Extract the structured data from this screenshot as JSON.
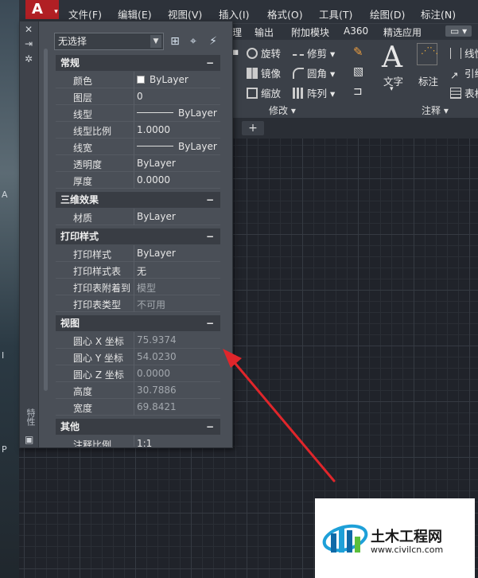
{
  "menubar": {
    "app_button_glyph": "A",
    "items": [
      "文件(F)",
      "编辑(E)",
      "视图(V)",
      "插入(I)",
      "格式(O)",
      "工具(T)",
      "绘图(D)",
      "标注(N)"
    ]
  },
  "ribbon": {
    "tabs": [
      "理",
      "输出",
      "附加模块",
      "A360",
      "精选应用"
    ],
    "modify_tools": [
      "旋转",
      "修剪",
      "镜像",
      "圆角",
      "缩放",
      "阵列"
    ],
    "text_tool": "文字",
    "dimension_tool": "标注",
    "right_tools": [
      "线性",
      "引线",
      "表格"
    ],
    "group_modify": "修改",
    "group_annotate": "注释",
    "big_glyph": "A"
  },
  "palette": {
    "title": "特性",
    "selection": "无选择",
    "sections": {
      "general": {
        "label": "常规",
        "rows": [
          {
            "key": "颜色",
            "value": "ByLayer"
          },
          {
            "key": "图层",
            "value": "0"
          },
          {
            "key": "线型",
            "value": "ByLayer"
          },
          {
            "key": "线型比例",
            "value": "1.0000"
          },
          {
            "key": "线宽",
            "value": "ByLayer"
          },
          {
            "key": "透明度",
            "value": "ByLayer"
          },
          {
            "key": "厚度",
            "value": "0.0000"
          }
        ]
      },
      "3d": {
        "label": "三维效果",
        "rows": [
          {
            "key": "材质",
            "value": "ByLayer"
          }
        ]
      },
      "plot": {
        "label": "打印样式",
        "rows": [
          {
            "key": "打印样式",
            "value": "ByLayer"
          },
          {
            "key": "打印样式表",
            "value": "无"
          },
          {
            "key": "打印表附着到",
            "value": "模型"
          },
          {
            "key": "打印表类型",
            "value": "不可用"
          }
        ]
      },
      "view": {
        "label": "视图",
        "rows": [
          {
            "key": "圆心 X 坐标",
            "value": "75.9374"
          },
          {
            "key": "圆心 Y 坐标",
            "value": "54.0230"
          },
          {
            "key": "圆心 Z 坐标",
            "value": "0.0000"
          },
          {
            "key": "高度",
            "value": "30.7886"
          },
          {
            "key": "宽度",
            "value": "69.8421"
          }
        ]
      },
      "misc": {
        "label": "其他",
        "rows": [
          {
            "key": "注释比例",
            "value": "1:1"
          }
        ]
      }
    }
  },
  "canvas": {
    "new_tab_glyph": "+"
  },
  "desktop": {
    "labels": [
      "A",
      "I",
      "P"
    ]
  },
  "watermark": {
    "title": "土木工程网",
    "url": "www.civilcn.com"
  },
  "colors": {
    "app_red": "#b11f24",
    "arrow_red": "#e0262b",
    "palette_bg": "#4a4f57"
  }
}
